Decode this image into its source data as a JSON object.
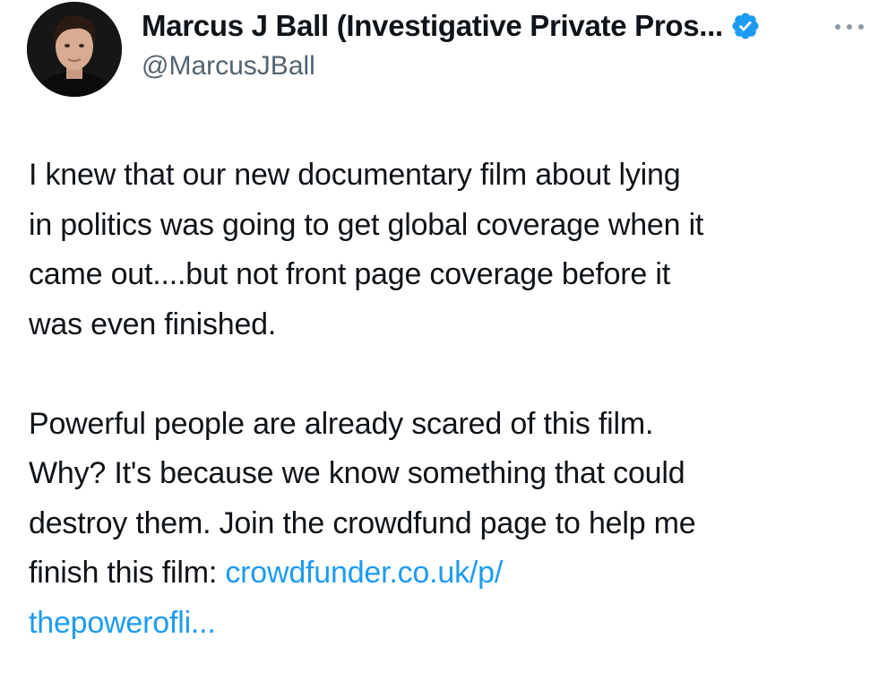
{
  "author": {
    "display_name": "Marcus J Ball (Investigative Private Pros...",
    "handle": "@MarcusJBall",
    "verified": true,
    "avatar_icon": "profile-photo-icon"
  },
  "more_icon": "more-horizontal-icon",
  "tweet": {
    "paragraph_1_lines": [
      "I knew that our new documentary film about lying",
      "in politics was going to get global coverage when it",
      "came out....but not front page coverage before it",
      "was even finished."
    ],
    "paragraph_2_lines": [
      "Powerful people are already scared of this film.",
      "Why? It's because we know something that could",
      "destroy them. Join the crowdfund page to help me"
    ],
    "paragraph_2_last_text": "finish this film: ",
    "link_line_1": "crowdfunder.co.uk/p/",
    "link_line_2": "thepowerofli..."
  },
  "colors": {
    "text": "#0f1419",
    "secondary": "#536471",
    "link": "#1d9bf0",
    "verified": "#1d9bf0"
  }
}
